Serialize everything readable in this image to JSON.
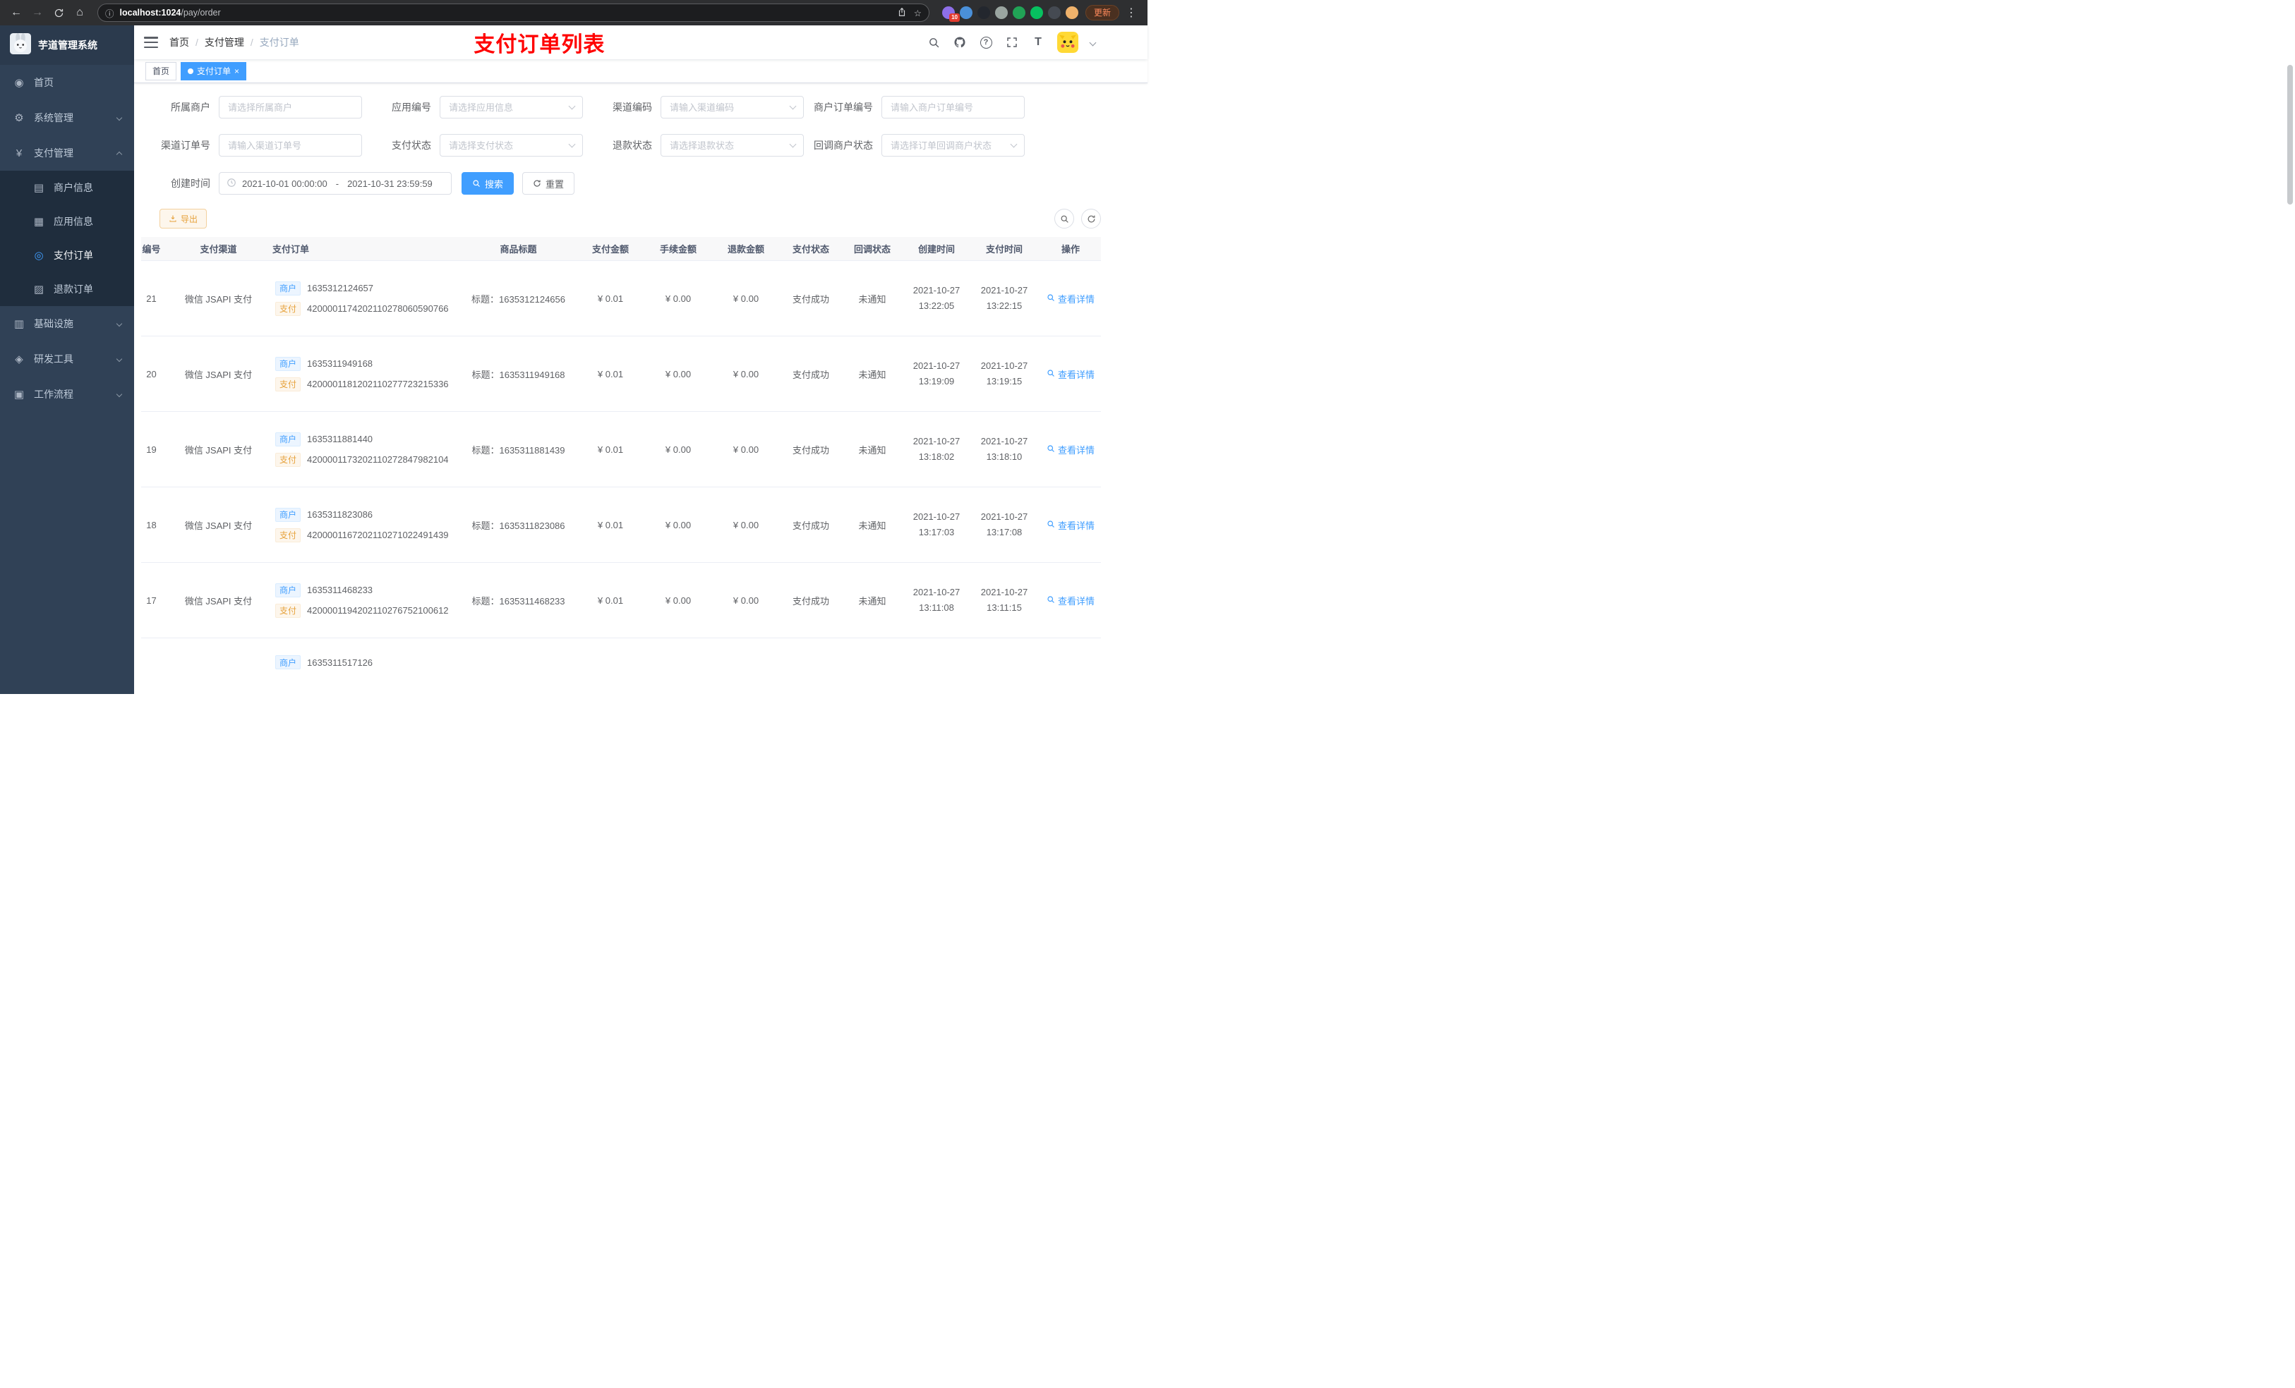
{
  "theme": {
    "accent": "#409eff",
    "banner_color": "#ff0000",
    "warning": "#e6a23c"
  },
  "browser": {
    "url_host": "localhost:1024",
    "url_path": "/pay/order",
    "update_label": "更新",
    "extensions": [
      {
        "color": "#8e6fe8",
        "badge": "10"
      },
      {
        "color": "#4a90d9",
        "badge": ""
      },
      {
        "color": "#23272e",
        "badge": ""
      },
      {
        "color": "#9aa5a0",
        "badge": ""
      },
      {
        "color": "#21a356",
        "badge": ""
      },
      {
        "color": "#07c160",
        "badge": ""
      },
      {
        "color": "#454a52",
        "badge": ""
      },
      {
        "color": "#f0b26b",
        "badge": ""
      }
    ]
  },
  "app": {
    "title": "芋道管理系统",
    "banner": "支付订单列表"
  },
  "sidebar": {
    "menu": [
      {
        "label": "首页",
        "icon": "home-icon",
        "type": "item"
      },
      {
        "label": "系统管理",
        "icon": "gear-icon",
        "type": "submenu",
        "expanded": false
      },
      {
        "label": "支付管理",
        "icon": "yen-icon",
        "type": "submenu",
        "expanded": true,
        "children": [
          {
            "label": "商户信息",
            "icon": "merchant-card-icon",
            "active": false
          },
          {
            "label": "应用信息",
            "icon": "app-grid-icon",
            "active": false
          },
          {
            "label": "支付订单",
            "icon": "pay-order-icon",
            "active": true
          },
          {
            "label": "退款订单",
            "icon": "refund-order-icon",
            "active": false
          }
        ]
      },
      {
        "label": "基础设施",
        "icon": "infra-icon",
        "type": "submenu",
        "expanded": false
      },
      {
        "label": "研发工具",
        "icon": "devtool-icon",
        "type": "submenu",
        "expanded": false
      },
      {
        "label": "工作流程",
        "icon": "workflow-icon",
        "type": "submenu",
        "expanded": false
      }
    ]
  },
  "breadcrumb": [
    {
      "label": "首页",
      "current": false
    },
    {
      "label": "支付管理",
      "current": false
    },
    {
      "label": "支付订单",
      "current": true
    }
  ],
  "tabs": [
    {
      "label": "首页",
      "active": false,
      "closable": false
    },
    {
      "label": "支付订单",
      "active": true,
      "closable": true
    }
  ],
  "filters": {
    "fields": [
      {
        "label": "所属商户",
        "placeholder": "请选择所属商户",
        "type": "input"
      },
      {
        "label": "应用编号",
        "placeholder": "请选择应用信息",
        "type": "select"
      },
      {
        "label": "渠道编码",
        "placeholder": "请输入渠道编码",
        "type": "select"
      },
      {
        "label": "商户订单编号",
        "placeholder": "请输入商户订单编号",
        "type": "input"
      },
      {
        "label": "渠道订单号",
        "placeholder": "请输入渠道订单号",
        "type": "input"
      },
      {
        "label": "支付状态",
        "placeholder": "请选择支付状态",
        "type": "select"
      },
      {
        "label": "退款状态",
        "placeholder": "请选择退款状态",
        "type": "select"
      },
      {
        "label": "回调商户状态",
        "placeholder": "请选择订单回调商户状态",
        "type": "select"
      }
    ],
    "date": {
      "label": "创建时间",
      "start": "2021-10-01 00:00:00",
      "separator": "-",
      "end": "2021-10-31 23:59:59"
    },
    "search_label": "搜索",
    "reset_label": "重置"
  },
  "toolbar": {
    "export_label": "导出"
  },
  "table": {
    "headers": [
      "编号",
      "支付渠道",
      "支付订单",
      "商品标题",
      "支付金额",
      "手续金额",
      "退款金额",
      "支付状态",
      "回调状态",
      "创建时间",
      "支付时间",
      "操作"
    ],
    "merchant_tag": "商户",
    "pay_tag": "支付",
    "title_prefix": "标题：",
    "action_label": "查看详情",
    "rows": [
      {
        "id": "21",
        "channel": "微信 JSAPI 支付",
        "merchant_no": "1635312124657",
        "pay_no": "4200001174202110278060590766",
        "title": "1635312124656",
        "amount": "¥ 0.01",
        "fee": "¥ 0.00",
        "refund": "¥ 0.00",
        "status": "支付成功",
        "notify": "未通知",
        "create_date": "2021-10-27",
        "create_time": "13:22:05",
        "pay_date": "2021-10-27",
        "pay_time": "13:22:15",
        "partial": false
      },
      {
        "id": "20",
        "channel": "微信 JSAPI 支付",
        "merchant_no": "1635311949168",
        "pay_no": "4200001181202110277723215336",
        "title": "1635311949168",
        "amount": "¥ 0.01",
        "fee": "¥ 0.00",
        "refund": "¥ 0.00",
        "status": "支付成功",
        "notify": "未通知",
        "create_date": "2021-10-27",
        "create_time": "13:19:09",
        "pay_date": "2021-10-27",
        "pay_time": "13:19:15",
        "partial": false
      },
      {
        "id": "19",
        "channel": "微信 JSAPI 支付",
        "merchant_no": "1635311881440",
        "pay_no": "4200001173202110272847982104",
        "title": "1635311881439",
        "amount": "¥ 0.01",
        "fee": "¥ 0.00",
        "refund": "¥ 0.00",
        "status": "支付成功",
        "notify": "未通知",
        "create_date": "2021-10-27",
        "create_time": "13:18:02",
        "pay_date": "2021-10-27",
        "pay_time": "13:18:10",
        "partial": false
      },
      {
        "id": "18",
        "channel": "微信 JSAPI 支付",
        "merchant_no": "1635311823086",
        "pay_no": "4200001167202110271022491439",
        "title": "1635311823086",
        "amount": "¥ 0.01",
        "fee": "¥ 0.00",
        "refund": "¥ 0.00",
        "status": "支付成功",
        "notify": "未通知",
        "create_date": "2021-10-27",
        "create_time": "13:17:03",
        "pay_date": "2021-10-27",
        "pay_time": "13:17:08",
        "partial": false
      },
      {
        "id": "17",
        "channel": "微信 JSAPI 支付",
        "merchant_no": "1635311468233",
        "pay_no": "4200001194202110276752100612",
        "title": "1635311468233",
        "amount": "¥ 0.01",
        "fee": "¥ 0.00",
        "refund": "¥ 0.00",
        "status": "支付成功",
        "notify": "未通知",
        "create_date": "2021-10-27",
        "create_time": "13:11:08",
        "pay_date": "2021-10-27",
        "pay_time": "13:11:15",
        "partial": false
      },
      {
        "id": "",
        "channel": "",
        "merchant_no": "1635311517126",
        "pay_no": "",
        "title": "",
        "amount": "",
        "fee": "",
        "refund": "",
        "status": "",
        "notify": "",
        "create_date": "",
        "create_time": "",
        "pay_date": "",
        "pay_time": "",
        "partial": true
      }
    ]
  }
}
